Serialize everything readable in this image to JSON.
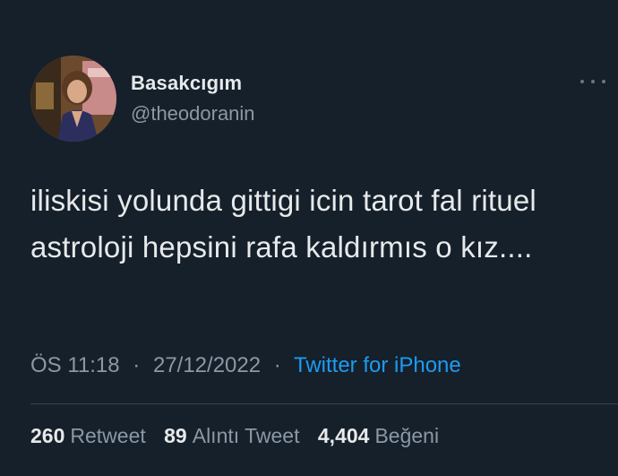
{
  "user": {
    "display_name": "Basakcıgım",
    "handle": "@theodoranin"
  },
  "more_icon": "more-horizontal-icon",
  "tweet": {
    "text": "iliskisi yolunda gittigi icin tarot fal rituel astroloji hepsini rafa kaldırmıs o kız...."
  },
  "meta": {
    "time": "ÖS 11:18",
    "separator": "·",
    "date": "27/12/2022",
    "source": "Twitter for iPhone"
  },
  "stats": {
    "retweets": {
      "count": "260",
      "label": "Retweet"
    },
    "quotes": {
      "count": "89",
      "label": "Alıntı Tweet"
    },
    "likes": {
      "count": "4,404",
      "label": "Beğeni"
    }
  },
  "colors": {
    "background": "#15202b",
    "text": "#e7e9ea",
    "secondary": "#8b98a5",
    "link": "#1d9bf0"
  }
}
